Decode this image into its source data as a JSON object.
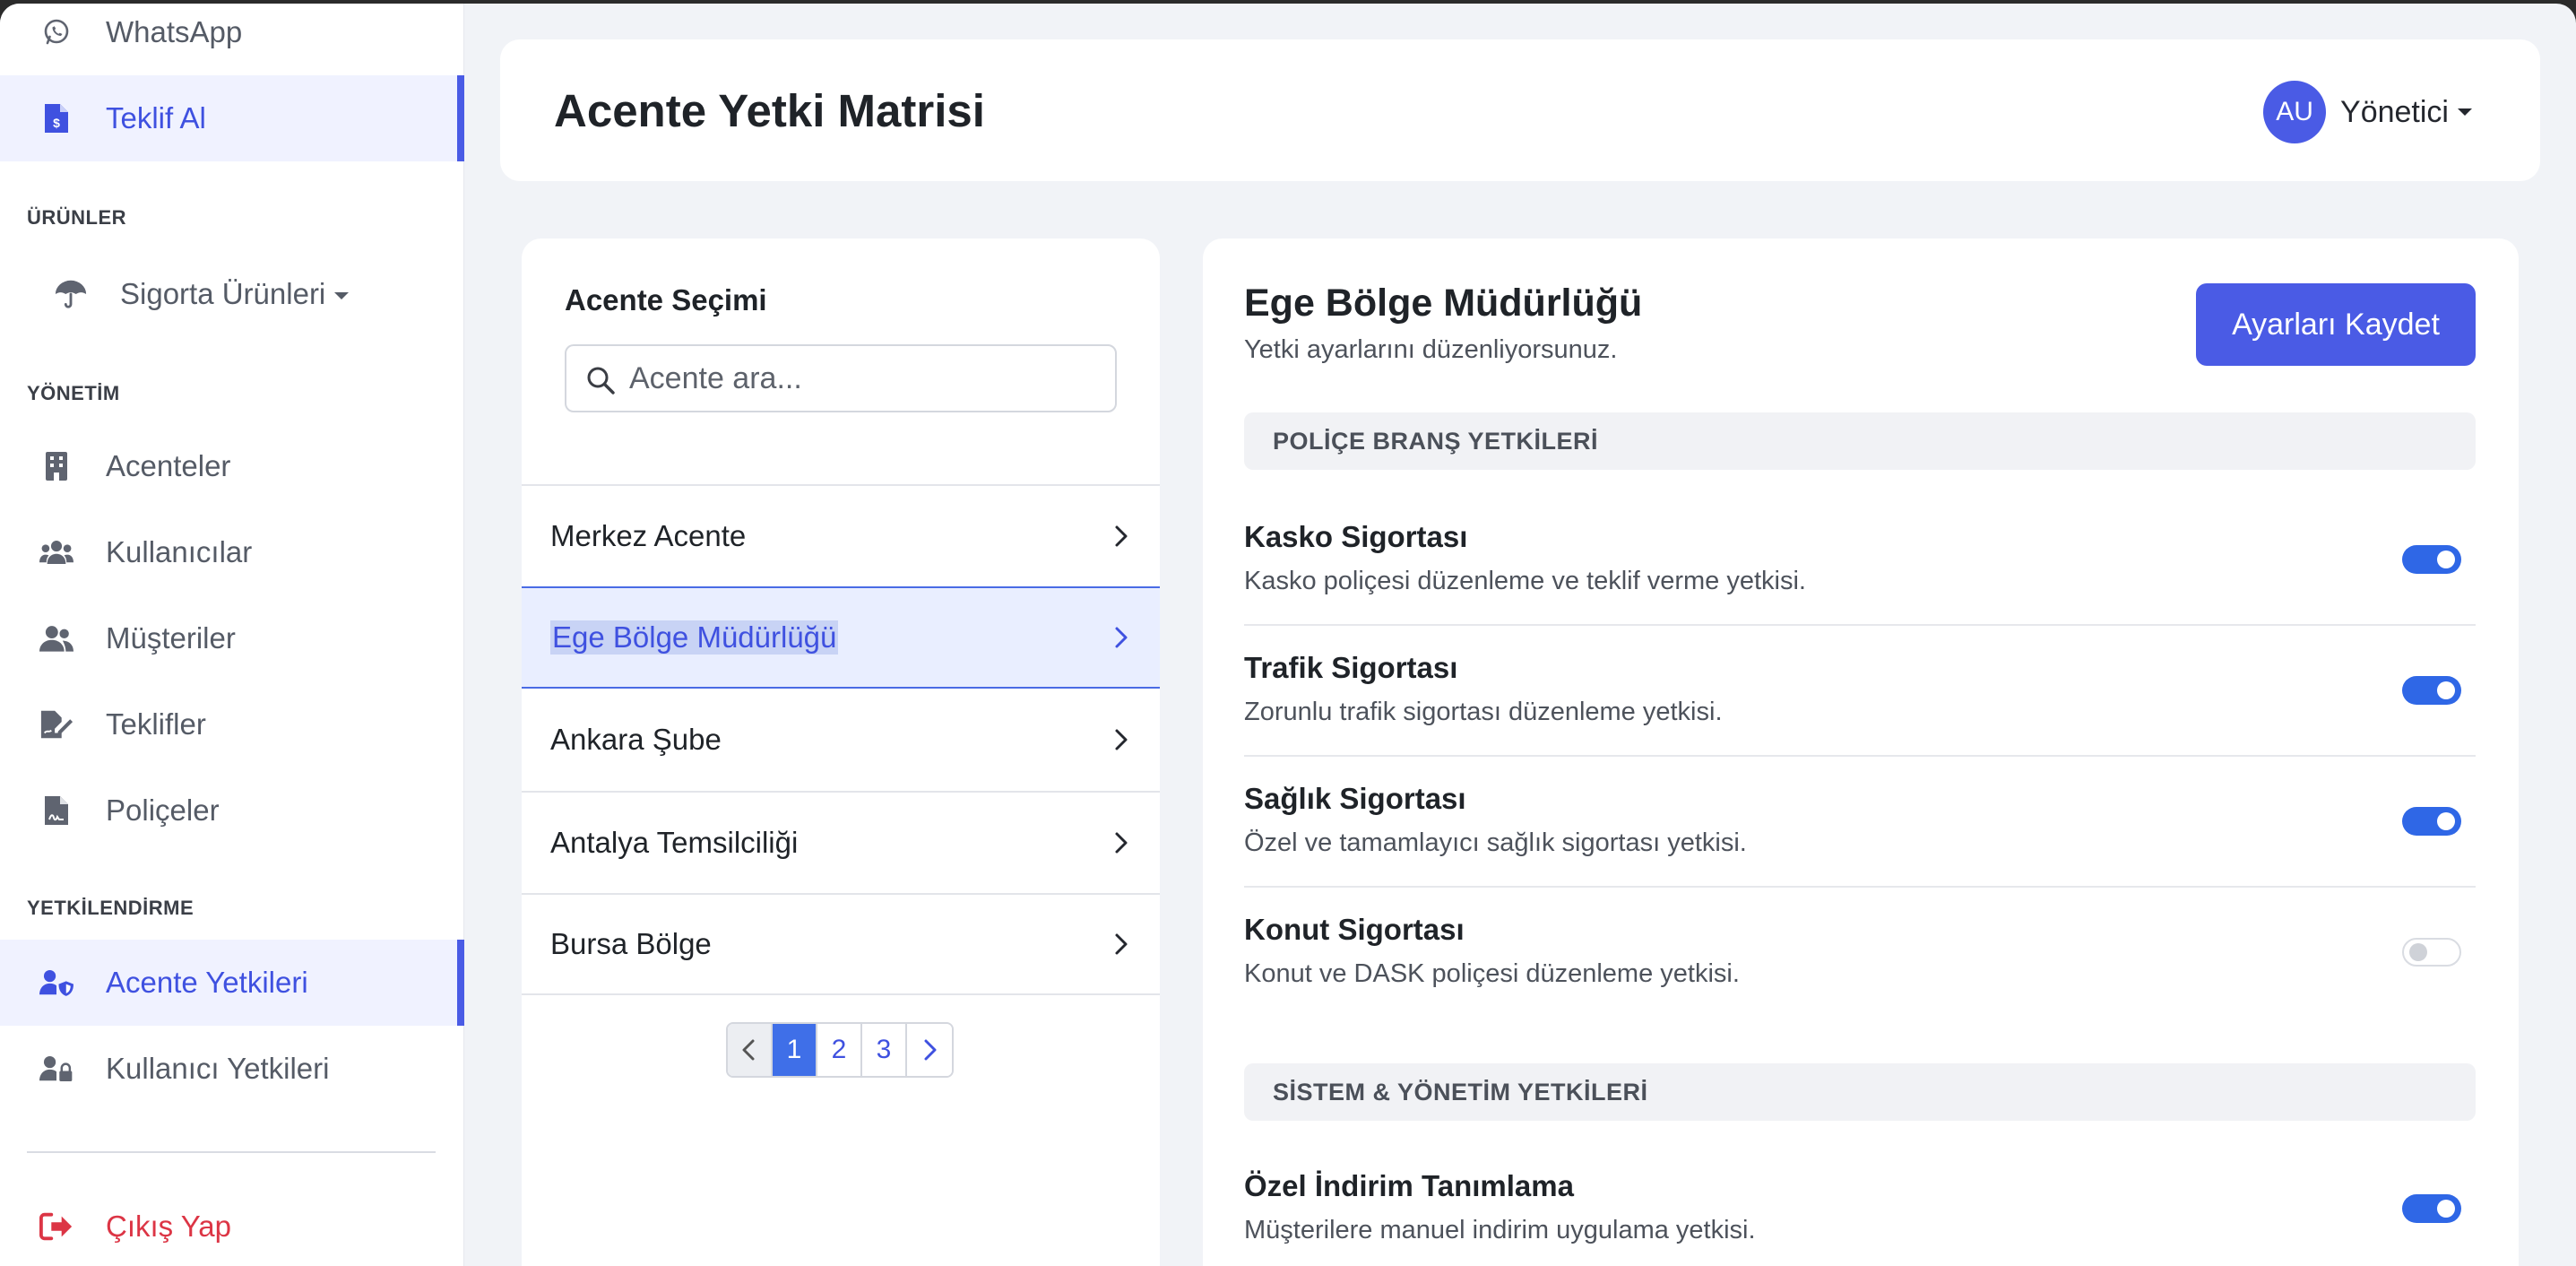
{
  "sidebar": {
    "top_items": [
      {
        "label": "WhatsApp",
        "icon": "whatsapp-icon"
      },
      {
        "label": "Teklif Al",
        "icon": "file-invoice-icon",
        "active": true
      }
    ],
    "sections": {
      "urunler": "ÜRÜNLER",
      "yonetim": "YÖNETİM",
      "yetkilendirme": "YETKİLENDİRME"
    },
    "products_dropdown": {
      "label": "Sigorta Ürünleri",
      "icon": "umbrella-icon"
    },
    "management_items": [
      {
        "label": "Acenteler",
        "icon": "building-icon"
      },
      {
        "label": "Kullanıcılar",
        "icon": "users-icon"
      },
      {
        "label": "Müşteriler",
        "icon": "user-group-icon"
      },
      {
        "label": "Teklifler",
        "icon": "file-signature-icon"
      },
      {
        "label": "Poliçeler",
        "icon": "file-contract-icon"
      }
    ],
    "auth_items": [
      {
        "label": "Acente Yetkileri",
        "icon": "user-shield-icon",
        "active": true
      },
      {
        "label": "Kullanıcı Yetkileri",
        "icon": "user-lock-icon"
      }
    ],
    "logout": {
      "label": "Çıkış Yap",
      "icon": "sign-out-icon"
    }
  },
  "header": {
    "title": "Acente Yetki Matrisi",
    "user": {
      "initials": "AU",
      "name": "Yönetici"
    }
  },
  "agency_panel": {
    "heading": "Acente Seçimi",
    "search_placeholder": "Acente ara...",
    "agencies": [
      {
        "name": "Merkez Acente"
      },
      {
        "name": "Ege Bölge Müdürlüğü",
        "selected": true
      },
      {
        "name": "Ankara Şube"
      },
      {
        "name": "Antalya Temsilciliği"
      },
      {
        "name": "Bursa Bölge"
      }
    ],
    "pagination": {
      "pages": [
        "1",
        "2",
        "3"
      ],
      "current": "1"
    }
  },
  "settings": {
    "title": "Ege Bölge Müdürlüğü",
    "subtitle": "Yetki ayarlarını düzenliyorsunuz.",
    "save_label": "Ayarları Kaydet",
    "groups": [
      {
        "title": "POLİÇE BRANŞ YETKİLERİ",
        "items": [
          {
            "title": "Kasko Sigortası",
            "desc": "Kasko poliçesi düzenleme ve teklif verme yetkisi.",
            "enabled": true
          },
          {
            "title": "Trafik Sigortası",
            "desc": "Zorunlu trafik sigortası düzenleme yetkisi.",
            "enabled": true
          },
          {
            "title": "Sağlık Sigortası",
            "desc": "Özel ve tamamlayıcı sağlık sigortası yetkisi.",
            "enabled": true
          },
          {
            "title": "Konut Sigortası",
            "desc": "Konut ve DASK poliçesi düzenleme yetkisi.",
            "enabled": false
          }
        ]
      },
      {
        "title": "SİSTEM & YÖNETİM YETKİLERİ",
        "items": [
          {
            "title": "Özel İndirim Tanımlama",
            "desc": "Müşterilere manuel indirim uygulama yetkisi.",
            "enabled": true
          }
        ]
      }
    ]
  },
  "colors": {
    "accent": "#4a5be5",
    "toggle_on": "#2f67e6",
    "danger": "#dc3545",
    "selected_bg": "#e9eeff"
  }
}
